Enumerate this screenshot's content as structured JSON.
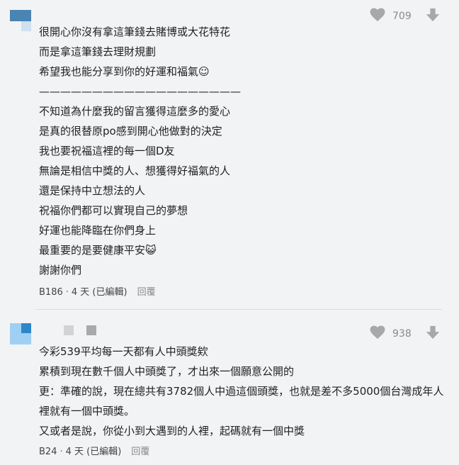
{
  "comments": [
    {
      "likes": "709",
      "lines": [
        "很開心你沒有拿這筆錢去賭博或大花特花",
        "而是拿這筆錢去理財規劃",
        "希望我也能分享到你的好運和福氣☺",
        "———————————————————",
        "不知道為什麼我的留言獲得這麼多的愛心",
        "是真的很替原po感到開心他做對的決定",
        "我也要祝福這裡的每一個D友",
        "無論是相信中獎的人、想獲得好福氣的人",
        "還是保持中立想法的人",
        "祝福你們都可以實現自己的夢想",
        "好運也能降臨在你們身上",
        "最重要的是要健康平安😺",
        "謝謝你們"
      ],
      "floor": "B186",
      "time": "4 天 (已編輯)",
      "reply": "回覆"
    },
    {
      "likes": "938",
      "lines": [
        "今彩539平均每一天都有人中頭獎欸",
        "累積到現在數千個人中頭獎了，才出來一個願意公開的",
        "更：準確的說，現在總共有3782個人中過這個頭獎，也就是差不多5000個台灣成年人裡就有一個中頭獎。",
        "又或者是說，你從小到大遇到的人裡，起碼就有一個中獎"
      ],
      "floor": "B24",
      "time": "4 天 (已編輯)",
      "reply": "回覆"
    }
  ],
  "colors": {
    "background": "#f2f3f4",
    "text": "#222222",
    "muted": "#8a8a8a",
    "icon": "#a8a8a8"
  },
  "icons": {
    "like": "heart-icon",
    "dislike": "arrow-down-icon"
  }
}
